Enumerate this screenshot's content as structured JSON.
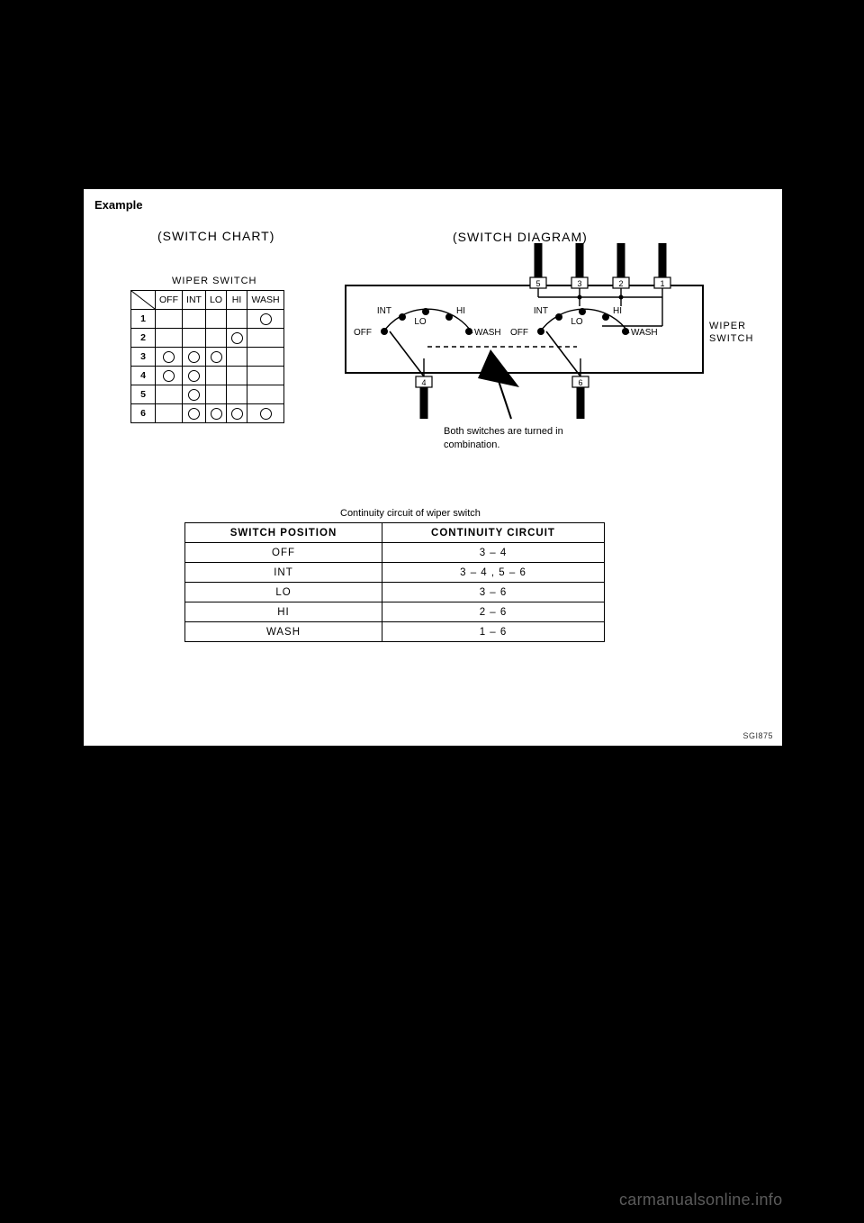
{
  "example_label": "Example",
  "switch_chart_label": "(SWITCH CHART)",
  "switch_diagram_label": "(SWITCH DIAGRAM)",
  "wiper_switch_caption": "WIPER SWITCH",
  "wiper_switch_side_label_1": "WIPER",
  "wiper_switch_side_label_2": "SWITCH",
  "chart_table": {
    "columns": [
      "OFF",
      "INT",
      "LO",
      "HI",
      "WASH"
    ],
    "row_labels": [
      "1",
      "2",
      "3",
      "4",
      "5",
      "6"
    ],
    "marks": {
      "1": {
        "WASH": true
      },
      "2": {
        "HI": true
      },
      "3": {
        "OFF": true,
        "INT": true,
        "LO": true
      },
      "4": {
        "OFF": true,
        "INT": true
      },
      "5": {
        "INT": true
      },
      "6": {
        "INT": true,
        "LO": true,
        "HI": true,
        "WASH": true
      }
    }
  },
  "diagram": {
    "terminals_top": [
      "5",
      "3",
      "2",
      "1"
    ],
    "terminals_bottom": [
      "4",
      "6"
    ],
    "positions": [
      "OFF",
      "INT",
      "LO",
      "HI",
      "WASH"
    ],
    "note_line1": "Both switches are turned in",
    "note_line2": "combination."
  },
  "continuity": {
    "caption": "Continuity circuit of wiper switch",
    "header1": "SWITCH POSITION",
    "header2": "CONTINUITY CIRCUIT",
    "rows": [
      {
        "pos": "OFF",
        "cc": "3 – 4"
      },
      {
        "pos": "INT",
        "cc": "3 – 4 , 5 – 6"
      },
      {
        "pos": "LO",
        "cc": "3 – 6"
      },
      {
        "pos": "HI",
        "cc": "2 – 6"
      },
      {
        "pos": "WASH",
        "cc": "1 – 6"
      }
    ]
  },
  "figure_ref": "SGI875",
  "watermark": "carmanualsonline.info"
}
